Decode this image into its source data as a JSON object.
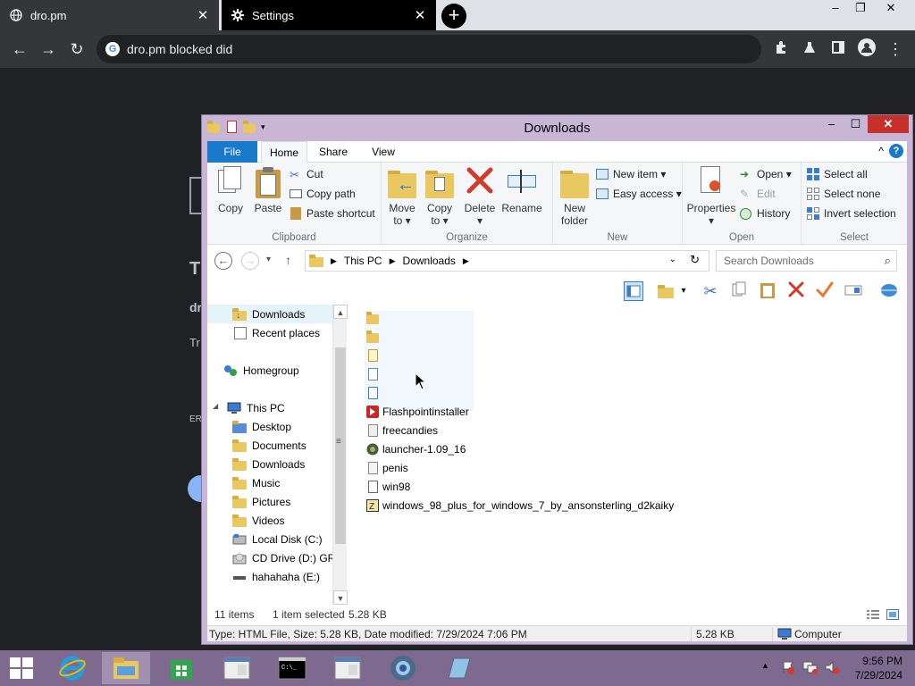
{
  "browser": {
    "tabs": [
      {
        "title": "dro.pm"
      },
      {
        "title": "Settings"
      }
    ],
    "address": "dro.pm blocked did",
    "window_controls": {
      "minimize": "–",
      "restore": "❐",
      "close": "✕"
    }
  },
  "page_bg_text": {
    "letter1": "T",
    "letter2": "dr",
    "letter3": "Tr",
    "letter4": "ER"
  },
  "explorer": {
    "title": "Downloads",
    "ribbon_tabs": [
      "File",
      "Home",
      "Share",
      "View"
    ],
    "clipboard": {
      "copy": "Copy",
      "paste": "Paste",
      "cut": "Cut",
      "copy_path": "Copy path",
      "paste_shortcut": "Paste shortcut",
      "label": "Clipboard"
    },
    "organize": {
      "move_to": "Move",
      "move_to2": "to ▾",
      "copy_to": "Copy",
      "copy_to2": "to ▾",
      "delete": "Delete",
      "delete2": "▾",
      "rename": "Rename",
      "label": "Organize"
    },
    "new": {
      "new_folder": "New",
      "new_folder2": "folder",
      "new_item": "New item ▾",
      "easy_access": "Easy access ▾",
      "label": "New"
    },
    "open": {
      "properties": "Properties",
      "properties2": "▾",
      "open": "Open ▾",
      "edit": "Edit",
      "history": "History",
      "label": "Open"
    },
    "select": {
      "select_all": "Select all",
      "select_none": "Select none",
      "invert": "Invert selection",
      "label": "Select"
    },
    "address_path": [
      "This PC",
      "Downloads"
    ],
    "search_placeholder": "Search Downloads",
    "nav": {
      "favorites": [
        "Downloads",
        "Recent places"
      ],
      "homegroup": "Homegroup",
      "this_pc": "This PC",
      "pc_items": [
        "Desktop",
        "Documents",
        "Downloads",
        "Music",
        "Pictures",
        "Videos",
        "Local Disk (C:)",
        "CD Drive (D:) GRM",
        "hahahaha (E:)"
      ]
    },
    "files": [
      "Flashpointinstaller",
      "freecandies",
      "launcher-1.09_16",
      "penis",
      "win98",
      "windows_98_plus_for_windows_7_by_ansonsterling_d2kaiky"
    ],
    "status": {
      "items": "11 items",
      "selected": "1 item selected",
      "size": "5.28 KB"
    },
    "details": {
      "info": "Type: HTML File, Size: 5.28 KB, Date modified: 7/29/2024 7:06 PM",
      "size": "5.28 KB",
      "location": "Computer"
    }
  },
  "taskbar": {
    "time": "9:56 PM",
    "date": "7/29/2024"
  }
}
